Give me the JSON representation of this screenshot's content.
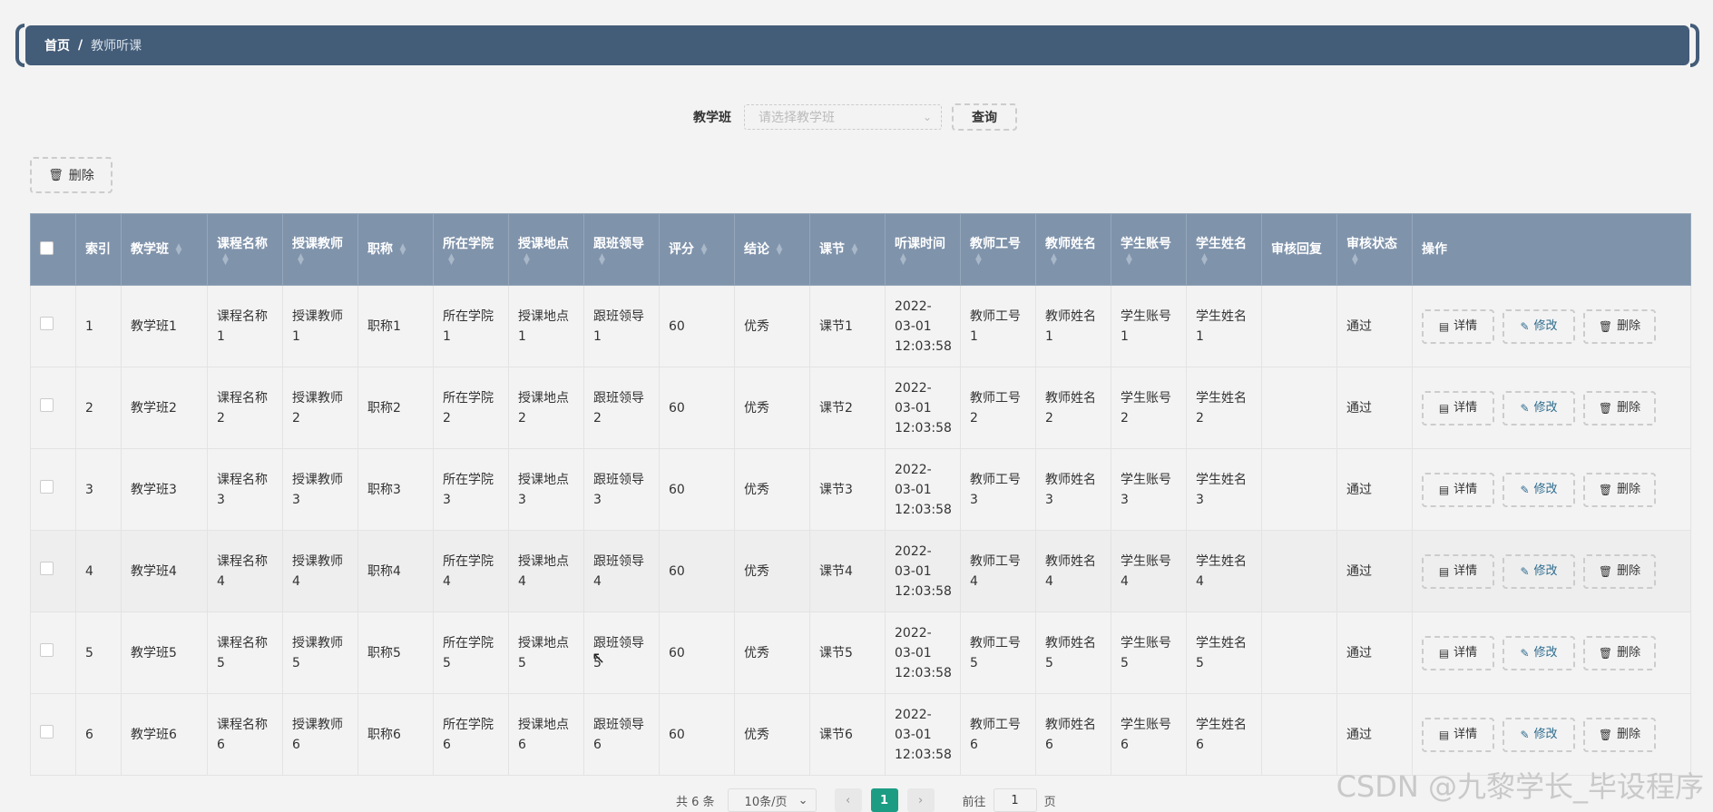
{
  "breadcrumb": {
    "home": "首页",
    "separator": "/",
    "current": "教师听课"
  },
  "search": {
    "label": "教学班",
    "placeholder": "请选择教学班",
    "query_label": "查询"
  },
  "toolbar": {
    "delete_label": "删除"
  },
  "table": {
    "headers": [
      "索引",
      "教学班",
      "课程名称",
      "授课教师",
      "职称",
      "所在学院",
      "授课地点",
      "跟班领导",
      "评分",
      "结论",
      "课节",
      "听课时间",
      "教师工号",
      "教师姓名",
      "学生账号",
      "学生姓名",
      "审核回复",
      "审核状态",
      "操作"
    ],
    "rows": [
      [
        "1",
        "教学班1",
        "课程名称1",
        "授课教师1",
        "职称1",
        "所在学院1",
        "授课地点1",
        "跟班领导1",
        "60",
        "优秀",
        "课节1",
        "2022-03-01 12:03:58",
        "教师工号1",
        "教师姓名1",
        "学生账号1",
        "学生姓名1",
        "",
        "通过"
      ],
      [
        "2",
        "教学班2",
        "课程名称2",
        "授课教师2",
        "职称2",
        "所在学院2",
        "授课地点2",
        "跟班领导2",
        "60",
        "优秀",
        "课节2",
        "2022-03-01 12:03:58",
        "教师工号2",
        "教师姓名2",
        "学生账号2",
        "学生姓名2",
        "",
        "通过"
      ],
      [
        "3",
        "教学班3",
        "课程名称3",
        "授课教师3",
        "职称3",
        "所在学院3",
        "授课地点3",
        "跟班领导3",
        "60",
        "优秀",
        "课节3",
        "2022-03-01 12:03:58",
        "教师工号3",
        "教师姓名3",
        "学生账号3",
        "学生姓名3",
        "",
        "通过"
      ],
      [
        "4",
        "教学班4",
        "课程名称4",
        "授课教师4",
        "职称4",
        "所在学院4",
        "授课地点4",
        "跟班领导4",
        "60",
        "优秀",
        "课节4",
        "2022-03-01 12:03:58",
        "教师工号4",
        "教师姓名4",
        "学生账号4",
        "学生姓名4",
        "",
        "通过"
      ],
      [
        "5",
        "教学班5",
        "课程名称5",
        "授课教师5",
        "职称5",
        "所在学院5",
        "授课地点5",
        "跟班领导5",
        "60",
        "优秀",
        "课节5",
        "2022-03-01 12:03:58",
        "教师工号5",
        "教师姓名5",
        "学生账号5",
        "学生姓名5",
        "",
        "通过"
      ],
      [
        "6",
        "教学班6",
        "课程名称6",
        "授课教师6",
        "职称6",
        "所在学院6",
        "授课地点6",
        "跟班领导6",
        "60",
        "优秀",
        "课节6",
        "2022-03-01 12:03:58",
        "教师工号6",
        "教师姓名6",
        "学生账号6",
        "学生姓名6",
        "",
        "通过"
      ]
    ],
    "actions": {
      "detail": "详情",
      "edit": "修改",
      "delete": "删除"
    }
  },
  "pagination": {
    "total": "共 6 条",
    "page_size": "10条/页",
    "current_page": "1",
    "goto_label": "前往",
    "goto_value": "1",
    "page_suffix": "页"
  },
  "watermark": "CSDN @九黎学长_毕设程序",
  "colors": {
    "header_bar": "#435c78",
    "table_header": "#7f93ab",
    "page_active": "#1d9c84"
  }
}
